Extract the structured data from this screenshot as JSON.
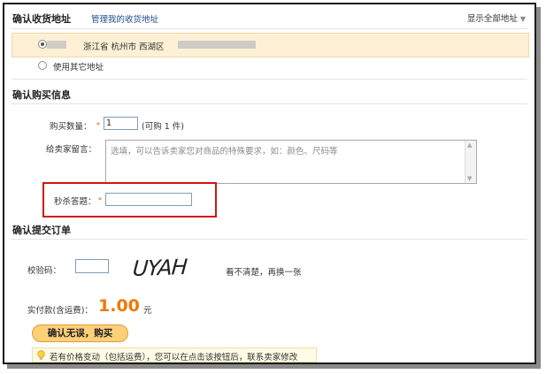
{
  "header": {
    "title": "确认收货地址",
    "manage_link": "管理我的收货地址",
    "show_all": "显示全部地址",
    "show_all_icon": "chevron-down-icon"
  },
  "address": {
    "selected_text": "浙江省 杭州市 西湖区",
    "other_option": "使用其它地址",
    "highlight_color": "#fdf0d5"
  },
  "purchase": {
    "section_title": "确认购买信息",
    "quantity_label": "购买数量：",
    "required_mark": "*",
    "quantity_value": "1",
    "quantity_note": "(可购 1 件)",
    "message_label": "给卖家留言：",
    "message_placeholder": "选填，可以告诉卖家您对商品的特殊要求，如：颜色、尺码等",
    "answer_label": "秒杀答题：",
    "answer_value": ""
  },
  "order": {
    "section_title": "确认提交订单",
    "code_label": "校验码：",
    "code_value": "",
    "captcha_text": "UYAH",
    "refresh_link": "看不清楚，再换一张",
    "total_label": "实付款(含运费)：",
    "total_value": "1.00",
    "total_unit": "元",
    "price_color": "#f07800",
    "submit_label": "确认无误，购买",
    "tip_icon": "lightbulb-icon",
    "tip_text": "若有价格变动（包括运费），您可以在点击该按钮后，联系卖家修改"
  }
}
